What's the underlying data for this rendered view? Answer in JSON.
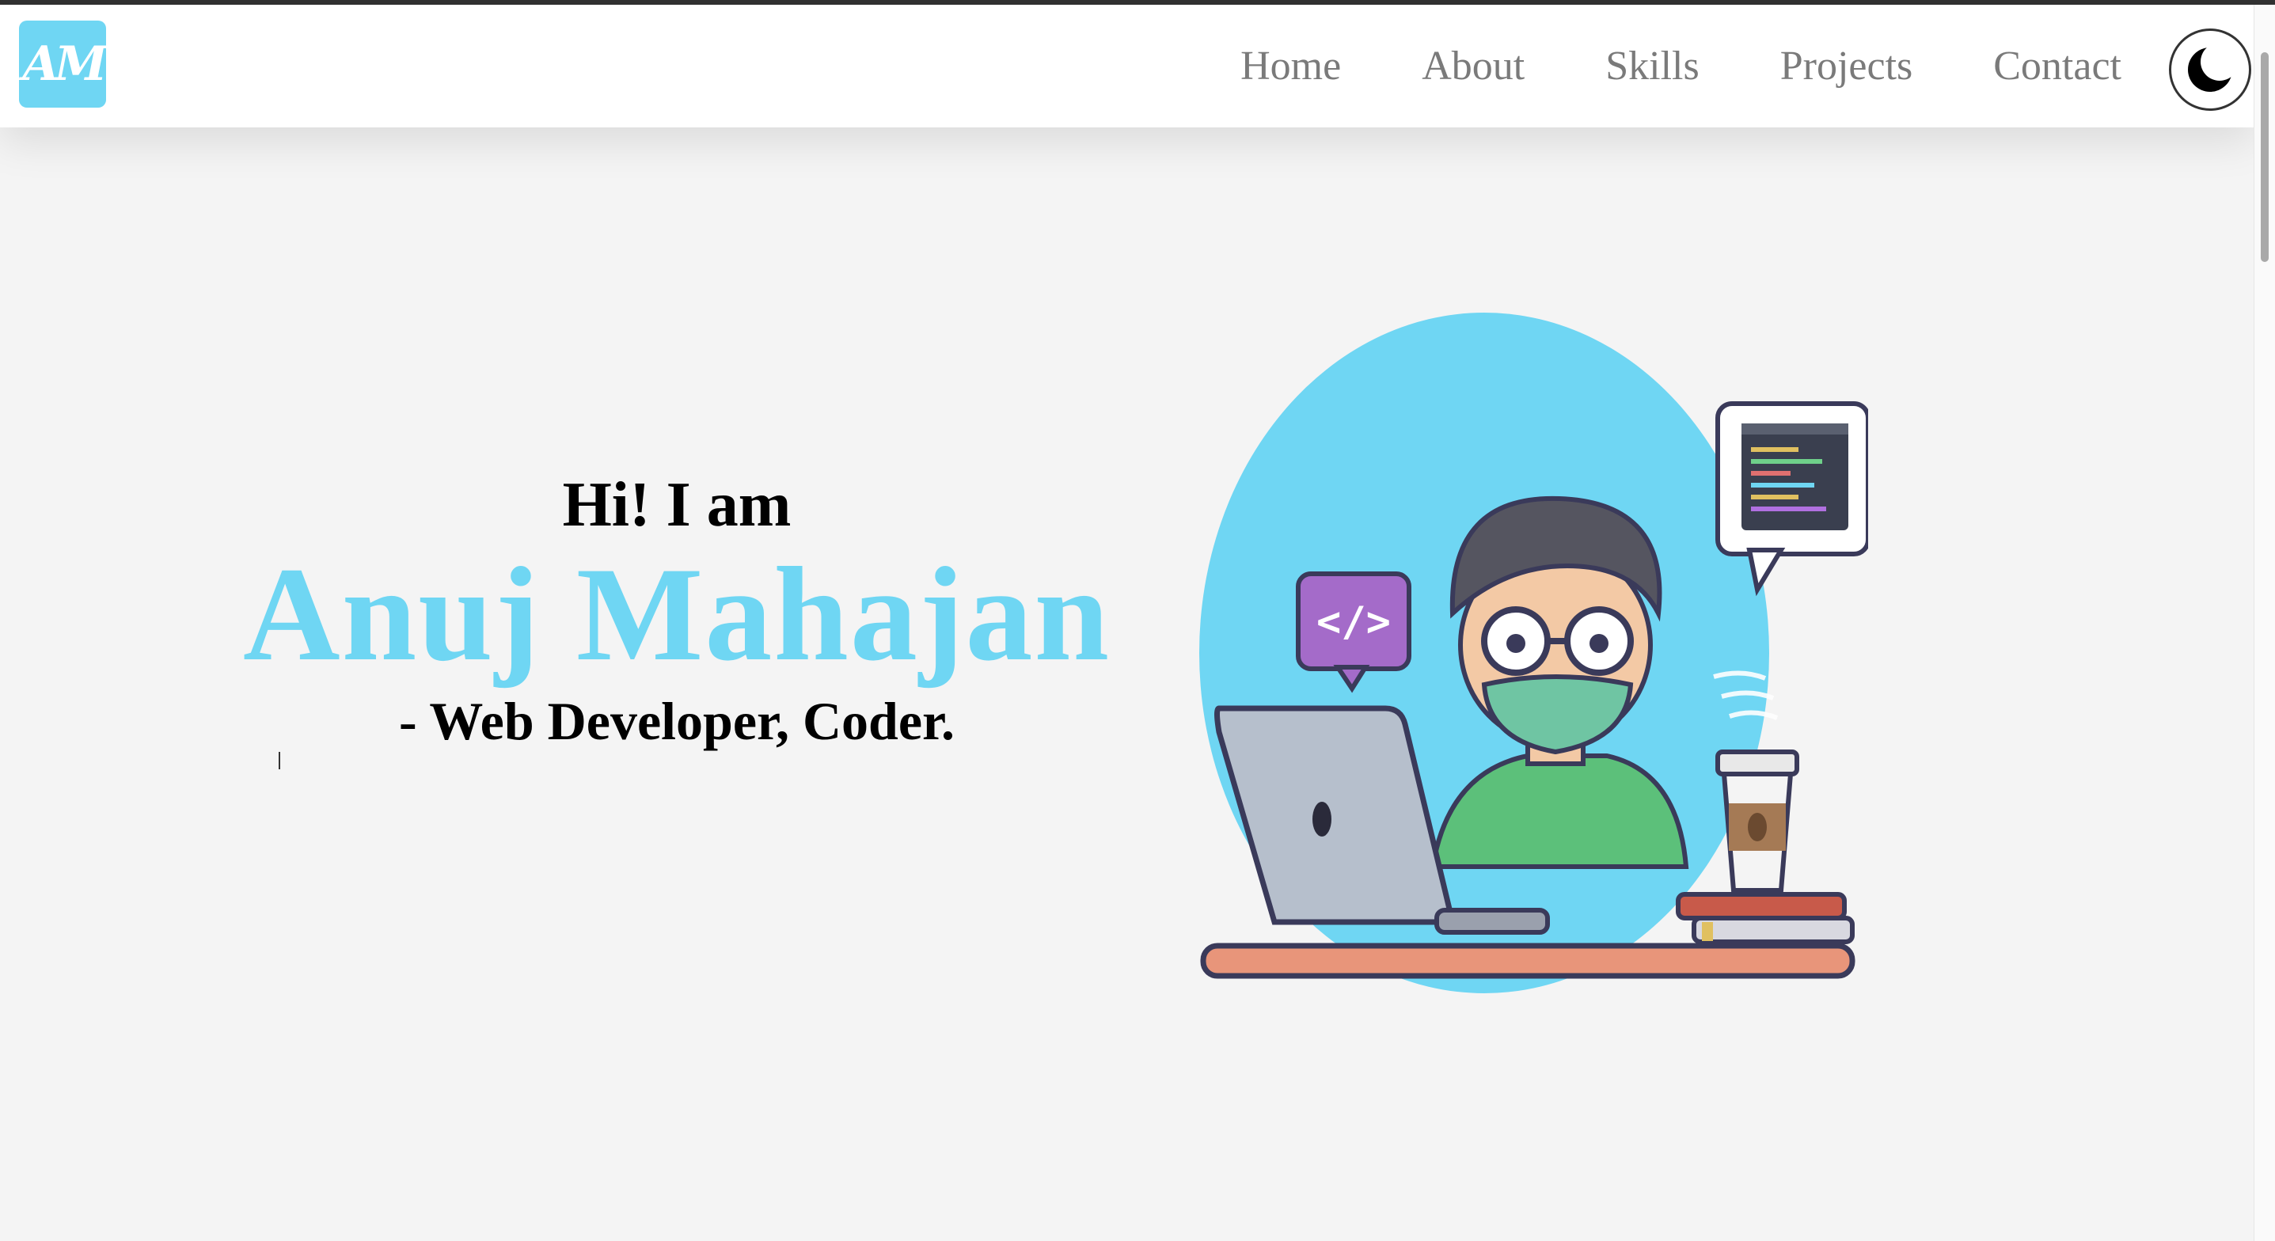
{
  "brand": {
    "logo_text": "AM",
    "accent_color": "#6fd6f3"
  },
  "nav": {
    "items": [
      {
        "label": "Home"
      },
      {
        "label": "About"
      },
      {
        "label": "Skills"
      },
      {
        "label": "Projects"
      },
      {
        "label": "Contact"
      }
    ],
    "theme_toggle_icon": "moon-icon"
  },
  "hero": {
    "greeting": "Hi! I am",
    "name": "Anuj Mahajan",
    "role": "- Web Developer, Coder.",
    "illustration": {
      "icons": [
        "developer-avatar",
        "code-tag-bubble",
        "code-window-bubble",
        "laptop",
        "coffee-cup",
        "books"
      ]
    }
  }
}
